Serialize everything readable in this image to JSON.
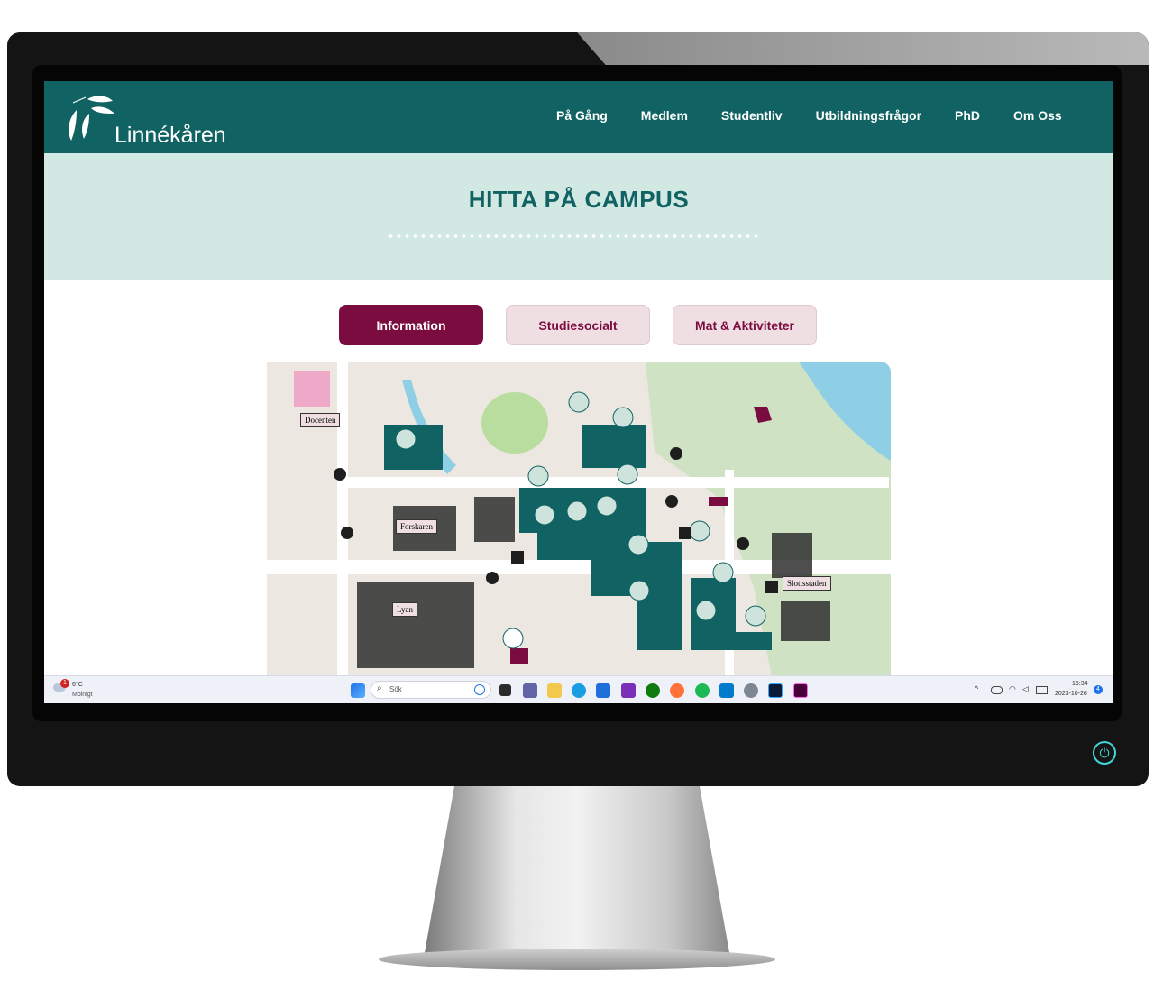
{
  "brand": {
    "name": "Linnékåren"
  },
  "nav": {
    "items": [
      {
        "label": "På Gång"
      },
      {
        "label": "Medlem"
      },
      {
        "label": "Studentliv"
      },
      {
        "label": "Utbildningsfrågor"
      },
      {
        "label": "PhD"
      },
      {
        "label": "Om Oss"
      }
    ]
  },
  "hero": {
    "title": "HITTA PÅ CAMPUS"
  },
  "tabs": [
    {
      "label": "Information",
      "active": true
    },
    {
      "label": "Studiesocialt",
      "active": false
    },
    {
      "label": "Mat & Aktiviteter",
      "active": false
    }
  ],
  "map": {
    "labels": [
      {
        "text": "Docenten"
      },
      {
        "text": "Forskaren"
      },
      {
        "text": "Lyan"
      },
      {
        "text": "Slottsstaden"
      }
    ]
  },
  "taskbar": {
    "weather_temp": "6°C",
    "weather_desc": "Molnigt",
    "weather_badge": "1",
    "search_placeholder": "Sök",
    "time": "16:34",
    "date": "2023-10-26",
    "notification_count": "4"
  },
  "colors": {
    "nav": "#116363",
    "hero": "#d2e8e2",
    "accent": "#7b0c3f",
    "tab_inactive": "#efdfe3"
  }
}
